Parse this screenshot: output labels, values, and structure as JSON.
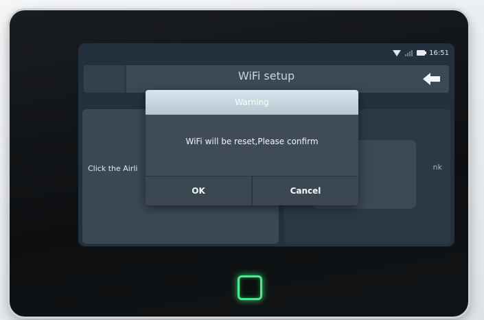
{
  "status_bar": {
    "time": "16:51",
    "icons": [
      "wifi-icon",
      "signal-icon",
      "battery-icon"
    ]
  },
  "header": {
    "title": "WiFi setup",
    "back_icon": "left-arrow-icon"
  },
  "left_panel": {
    "hint_text": "Click the Airli"
  },
  "right_panel": {
    "partial_text": "nk"
  },
  "dialog": {
    "title": "Warning",
    "message": "WiFi will be reset,Please confirm",
    "ok_label": "OK",
    "cancel_label": "Cancel"
  },
  "device": {
    "home_button_color": "#43f08a",
    "home_icon": "home-square-icon"
  }
}
